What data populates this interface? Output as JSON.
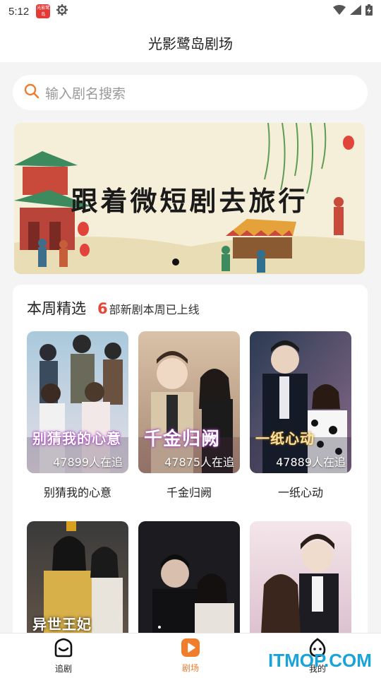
{
  "status_bar": {
    "time": "5:12",
    "app_icon_text": "光影鹭岛",
    "settings_icon": "gear-icon",
    "wifi_icon": "wifi-icon",
    "signal_icon": "signal-icon",
    "battery_icon": "battery-charging-icon"
  },
  "header": {
    "title": "光影鹭岛剧场"
  },
  "search": {
    "placeholder": "输入剧名搜索",
    "icon": "search-icon",
    "accent": "#f07d2c"
  },
  "banner": {
    "text": "跟着微短剧去旅行",
    "active_slide": 1,
    "slide_count": 1
  },
  "weekly": {
    "title": "本周精选",
    "count": "6",
    "subtitle": "部新剧本周已上线",
    "count_color": "#e5483a",
    "items": [
      {
        "poster_title": "别猜我的心意",
        "watchers": "47899人在追",
        "name": "别猜我的心意"
      },
      {
        "poster_title": "千金归阙",
        "watchers": "47875人在追",
        "name": "千金归阙"
      },
      {
        "poster_title": "一纸心动",
        "watchers": "47889人在追",
        "name": "一纸心动"
      },
      {
        "poster_title": "异世王妃",
        "watchers": "",
        "name": ""
      },
      {
        "poster_title": "",
        "watchers": "",
        "name": ""
      },
      {
        "poster_title": "",
        "watchers": "",
        "name": ""
      }
    ]
  },
  "bottom_nav": {
    "items": [
      {
        "label": "追剧",
        "icon": "smile-house-icon"
      },
      {
        "label": "剧场",
        "icon": "play-icon",
        "active": true
      },
      {
        "label": "我的",
        "icon": "profile-face-icon"
      }
    ],
    "active_color": "#f07d2c"
  },
  "watermark": {
    "text": "ITMOP.COM"
  }
}
